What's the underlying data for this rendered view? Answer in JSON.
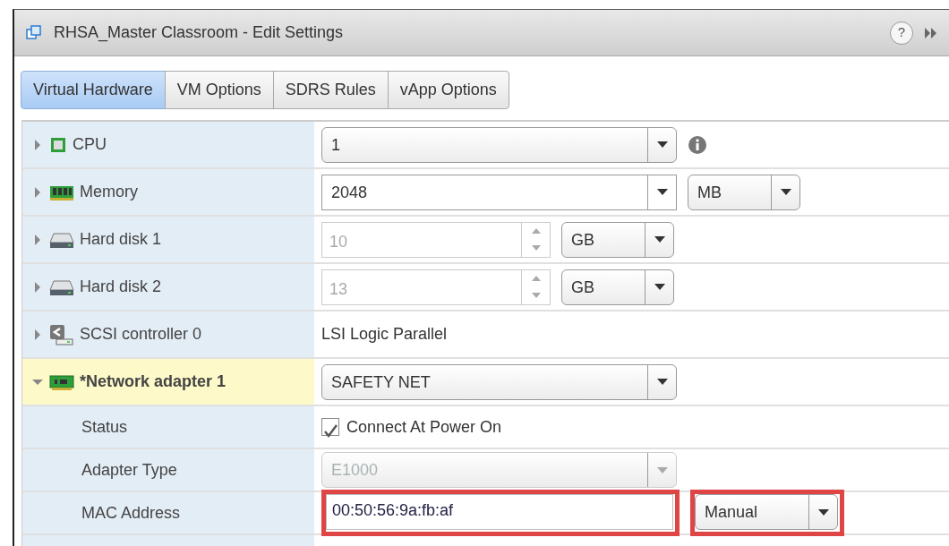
{
  "window": {
    "title": "RHSA_Master Classroom - Edit Settings",
    "help": "?"
  },
  "tabs": [
    {
      "label": "Virtual Hardware",
      "selected": true
    },
    {
      "label": "VM Options",
      "selected": false
    },
    {
      "label": "SDRS Rules",
      "selected": false
    },
    {
      "label": "vApp Options",
      "selected": false
    }
  ],
  "rows": [
    {
      "kind": "cpu",
      "label": "CPU",
      "expanded": false,
      "modified": false,
      "controls": [
        {
          "kind": "combo",
          "value": "1",
          "editable": false
        },
        {
          "kind": "info"
        }
      ]
    },
    {
      "kind": "memory",
      "label": "Memory",
      "expanded": false,
      "modified": false,
      "controls": [
        {
          "kind": "combo",
          "value": "2048",
          "editable": true
        },
        {
          "kind": "select",
          "value": "MB"
        }
      ]
    },
    {
      "kind": "disk",
      "label": "Hard disk 1",
      "expanded": false,
      "modified": false,
      "controls": [
        {
          "kind": "spinner",
          "value": "10",
          "disabled": true
        },
        {
          "kind": "select",
          "value": "GB"
        }
      ]
    },
    {
      "kind": "disk",
      "label": "Hard disk 2",
      "expanded": false,
      "modified": false,
      "controls": [
        {
          "kind": "spinner",
          "value": "13",
          "disabled": true
        },
        {
          "kind": "select",
          "value": "GB"
        }
      ]
    },
    {
      "kind": "scsi",
      "label": "SCSI controller 0",
      "expanded": false,
      "modified": false,
      "controls": [
        {
          "kind": "text",
          "value": "LSI Logic Parallel"
        }
      ]
    },
    {
      "kind": "network",
      "label": "*Network adapter 1",
      "expanded": true,
      "modified": true,
      "controls": [
        {
          "kind": "wideselect",
          "value": "SAFETY NET",
          "disabled": false
        }
      ]
    },
    {
      "kind": "sub",
      "label": "Status",
      "controls": [
        {
          "kind": "checkbox",
          "value": "Connect At Power On",
          "checked": true
        }
      ]
    },
    {
      "kind": "sub",
      "label": "Adapter Type",
      "controls": [
        {
          "kind": "wideselect",
          "value": "E1000",
          "disabled": true
        }
      ]
    },
    {
      "kind": "sub",
      "label": "MAC Address",
      "controls": [
        {
          "kind": "field",
          "value": "00:50:56:9a:fb:af",
          "highlighted": true
        },
        {
          "kind": "select",
          "value": "Manual",
          "highlighted": true
        }
      ]
    },
    {
      "kind": "cut",
      "controls": []
    }
  ]
}
